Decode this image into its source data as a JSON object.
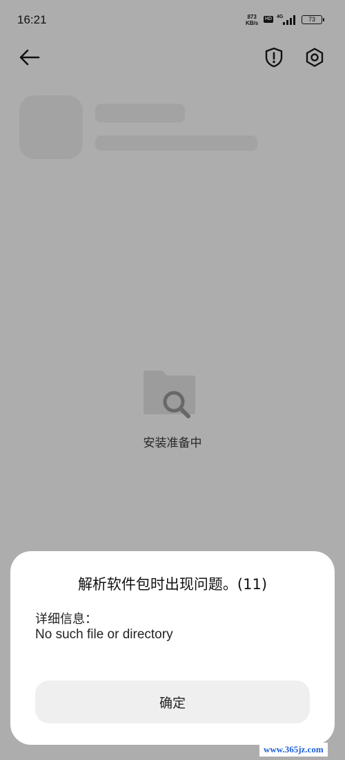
{
  "status_bar": {
    "time": "16:21",
    "net_speed_value": "873",
    "net_speed_unit": "KB/s",
    "hd_label": "HD",
    "network_type": "4G",
    "battery_level": "73"
  },
  "header": {
    "back_icon": "arrow-left-icon",
    "security_icon": "shield-exclamation-icon",
    "settings_icon": "gear-icon"
  },
  "main": {
    "status_text": "安装准备中",
    "empty_icon": "folder-search-icon"
  },
  "dialog": {
    "title": "解析软件包时出现问题。(11)",
    "detail_label": "详细信息：",
    "detail_message": "No such file or directory",
    "confirm_label": "确定"
  },
  "watermark": "www.365jz.com",
  "colors": {
    "scrim": "#000000",
    "skeleton": "#f1f1f1",
    "button_bg": "#efefef",
    "watermark": "#1e5fd6"
  }
}
